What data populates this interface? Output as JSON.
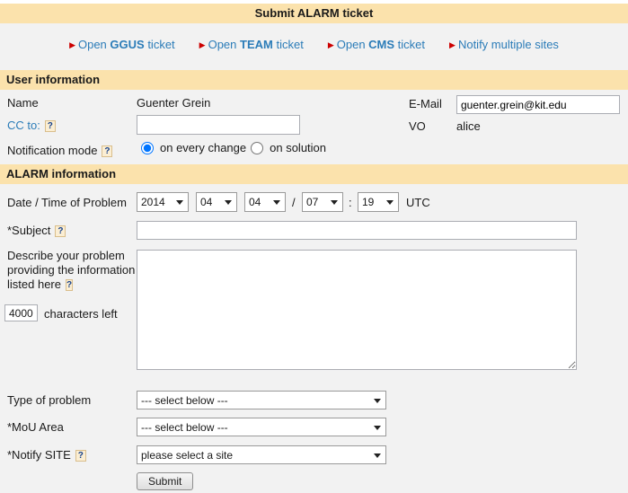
{
  "page": {
    "title": "Submit ALARM ticket"
  },
  "colors": {
    "section_bg": "#FBE2AC",
    "page_bg": "#F2F2F2",
    "link_blue": "#2B7CB8",
    "arrow_red": "#CC0000"
  },
  "icons": {
    "arrow": "▶",
    "help": "?"
  },
  "links": [
    {
      "pre": "Open ",
      "bold": "GGUS",
      "post": " ticket"
    },
    {
      "pre": "Open ",
      "bold": "TEAM",
      "post": " ticket"
    },
    {
      "pre": "Open ",
      "bold": "CMS",
      "post": " ticket"
    },
    {
      "pre": "Notify multiple sites",
      "bold": "",
      "post": ""
    }
  ],
  "user_info": {
    "header": "User information",
    "name_label": "Name",
    "name_value": "Guenter Grein",
    "email_label": "E-Mail",
    "email_value": "guenter.grein@kit.edu",
    "cc_label": "CC to:",
    "vo_label": "VO",
    "vo_value": "alice",
    "notification_label": "Notification mode",
    "radio_option_1": "on every change",
    "radio_option_2": "on solution"
  },
  "alarm_info": {
    "header": "ALARM information",
    "date_label": "Date / Time of Problem",
    "date_year": "2014",
    "date_month": "04",
    "date_day": "04",
    "date_separator": "/",
    "time_hour": "07",
    "time_separator": ":",
    "time_minute": "19",
    "timezone": "UTC",
    "subject_label": "*Subject",
    "describe_line1": "Describe your problem",
    "describe_line2": "providing the information",
    "describe_line3": "listed here",
    "chars_left_value": "4000",
    "chars_left_label": "characters left",
    "type_label": "Type of problem",
    "type_value": "--- select below ---",
    "mou_label": "*MoU Area",
    "mou_value": "--- select below ---",
    "site_label": "*Notify SITE",
    "site_value": "please select a site",
    "submit_label": "Submit"
  }
}
